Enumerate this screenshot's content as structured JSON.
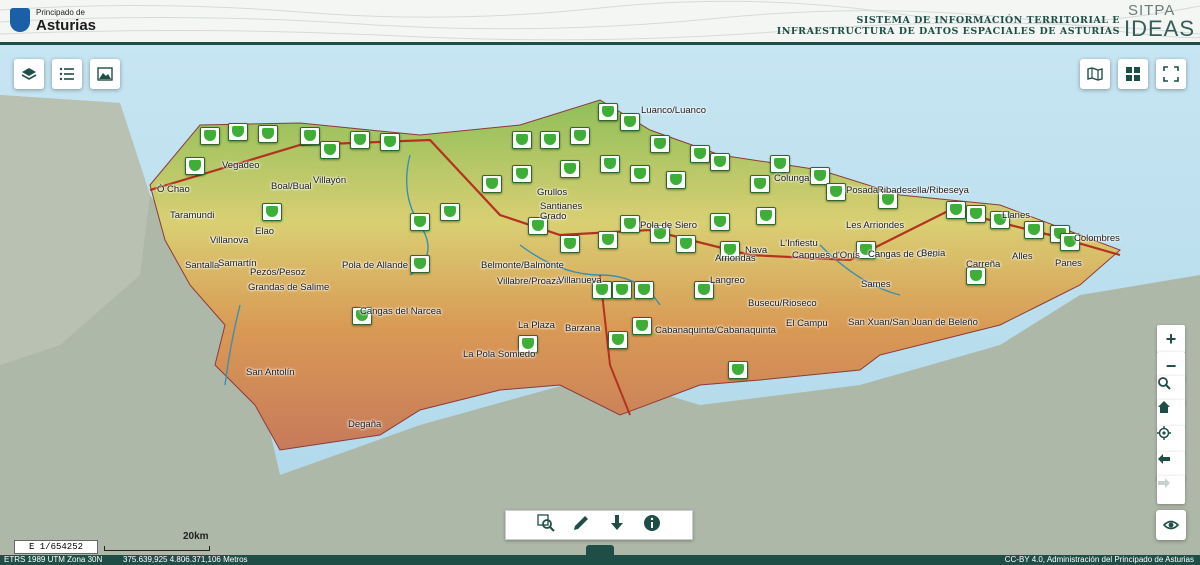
{
  "header": {
    "logo_small": "Principado de",
    "logo_big": "Asturias",
    "system_line1": "SISTEMA DE INFORMACIÓN TERRITORIAL E",
    "system_line2": "INFRAESTRUCTURA DE DATOS ESPACIALES DE ASTURIAS",
    "brand_top": "SITPA",
    "brand_bottom": "IDEAS"
  },
  "toolbar_left": [
    {
      "name": "layers-button",
      "icon": "layers-icon"
    },
    {
      "name": "legend-button",
      "icon": "list-icon"
    },
    {
      "name": "basemap-button",
      "icon": "map-picture-icon"
    }
  ],
  "toolbar_right": [
    {
      "name": "map-view-button",
      "icon": "map-icon"
    },
    {
      "name": "grid-button",
      "icon": "grid-icon"
    },
    {
      "name": "fullscreen-button",
      "icon": "fullscreen-icon"
    }
  ],
  "zoom_controls": {
    "plus": "+",
    "minus": "−"
  },
  "places": [
    {
      "text": "Luanco/Luanco"
    },
    {
      "text": "Ò Chao"
    },
    {
      "text": "Vegadeo"
    },
    {
      "text": "Boal/Bual"
    },
    {
      "text": "Villayón"
    },
    {
      "text": "Taramundi"
    },
    {
      "text": "Grullos"
    },
    {
      "text": "Santianes"
    },
    {
      "text": "Grado"
    },
    {
      "text": "Villanova"
    },
    {
      "text": "Elao"
    },
    {
      "text": "Santalla"
    },
    {
      "text": "Samartín"
    },
    {
      "text": "Pezós/Pesoz"
    },
    {
      "text": "Grandas de Salime"
    },
    {
      "text": "Pola de Allande"
    },
    {
      "text": "Belmonte/Balmonte"
    },
    {
      "text": "Villabre/Proaza"
    },
    {
      "text": "Villanueva"
    },
    {
      "text": "Cangas del Narcea"
    },
    {
      "text": "La Plaza"
    },
    {
      "text": "Barzana"
    },
    {
      "text": "La Pola Somiedo"
    },
    {
      "text": "San Antolín"
    },
    {
      "text": "Degaña"
    },
    {
      "text": "Cabanaquinta/Cabanaquinta"
    },
    {
      "text": "El Campu"
    },
    {
      "text": "Busecu/Rioseco"
    },
    {
      "text": "Langreo"
    },
    {
      "text": "L'Infiestu"
    },
    {
      "text": "Cangues d'Onís"
    },
    {
      "text": "Cangas de Onís"
    },
    {
      "text": "Benia"
    },
    {
      "text": "Arriondas"
    },
    {
      "text": "Sames"
    },
    {
      "text": "San Xuan/San Juan de Beleño"
    },
    {
      "text": "Carreña"
    },
    {
      "text": "Alles"
    },
    {
      "text": "Panes"
    },
    {
      "text": "Colombres"
    },
    {
      "text": "Ribadesella/Ribeseya"
    },
    {
      "text": "Llanes"
    },
    {
      "text": "Colunga"
    },
    {
      "text": "Nava"
    },
    {
      "text": "Pola de Siero"
    },
    {
      "text": "Les Arriondes"
    },
    {
      "text": "Posada"
    }
  ],
  "bottom_tools": [
    {
      "name": "search-zoom-button",
      "icon": "search-zoom-icon"
    },
    {
      "name": "draw-button",
      "icon": "pencil-icon"
    },
    {
      "name": "download-button",
      "icon": "download-icon"
    },
    {
      "name": "info-button",
      "icon": "info-icon"
    }
  ],
  "scale": {
    "ratio": "E 1/654252",
    "bar_label": "20km"
  },
  "status": {
    "crs": "ETRS 1989 UTM Zona 30N",
    "coords": "375.639,925 4.806.371,106 Metros",
    "license": "CC-BY 4.0, Administración del Principado de Asturias"
  }
}
